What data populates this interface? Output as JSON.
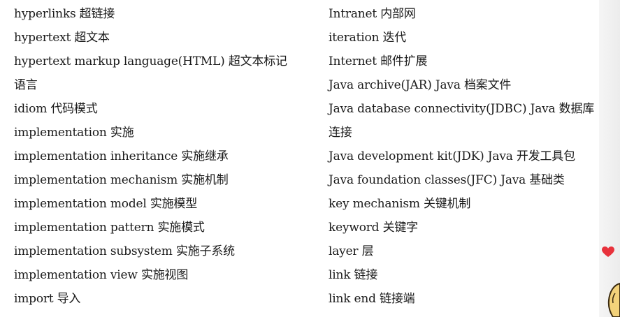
{
  "glossary": {
    "left": [
      "hyperlinks 超链接",
      "hypertext 超文本",
      "hypertext markup language(HTML)  超文本标记",
      "语言",
      "idiom 代码模式",
      "implementation 实施",
      "implementation inheritance 实施继承",
      "implementation mechanism 实施机制",
      "implementation model 实施模型",
      "implementation pattern 实施模式",
      "implementation subsystem 实施子系统",
      "implementation view 实施视图",
      "import 导入"
    ],
    "right": [
      "Intranet 内部网",
      "iteration 迭代",
      "Internet  邮件扩展",
      "Java archive(JAR) Java 档案文件",
      "Java database connectivity(JDBC)  Java 数据库",
      "连接",
      "Java development kit(JDK)  Java 开发工具包",
      "Java foundation classes(JFC)  Java 基础类",
      "key mechanism 关键机制",
      "keyword 关键字",
      "layer 层",
      "link 链接",
      "link end 链接端"
    ]
  },
  "decorations": {
    "heart_icon": "heart-icon",
    "heart_color": "#e8323c",
    "corner_icon": "cartoon-corner-icon",
    "corner_fill": "#f3d27a",
    "corner_stroke": "#3a2a10"
  }
}
